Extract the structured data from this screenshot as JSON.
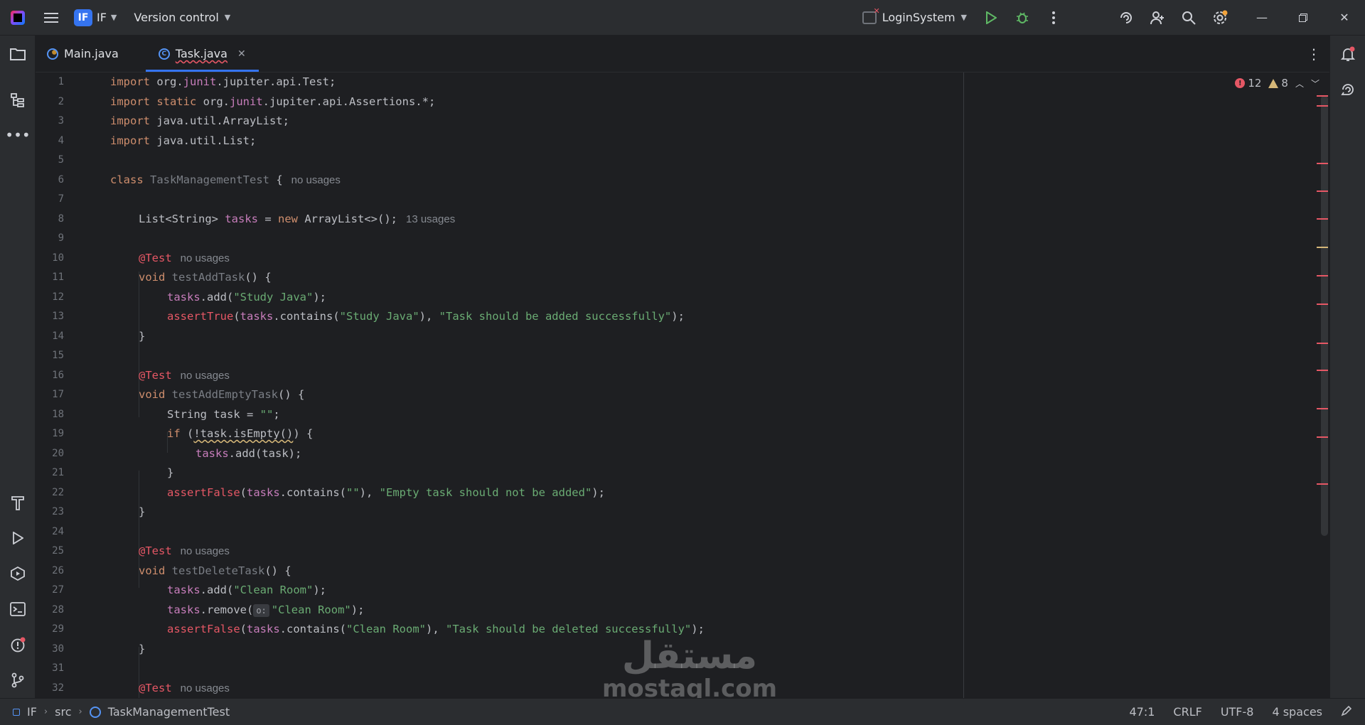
{
  "titlebar": {
    "project_badge": "IF",
    "project_name": "IF",
    "vcs_label": "Version control",
    "run_config": "LoginSystem"
  },
  "tabs": [
    {
      "label": "Main.java",
      "active": false
    },
    {
      "label": "Task.java",
      "active": true
    }
  ],
  "inspections": {
    "errors": "12",
    "warnings": "8"
  },
  "line_numbers": [
    "1",
    "2",
    "3",
    "4",
    "5",
    "6",
    "7",
    "8",
    "9",
    "10",
    "11",
    "12",
    "13",
    "14",
    "15",
    "16",
    "17",
    "18",
    "19",
    "20",
    "21",
    "22",
    "23",
    "24",
    "25",
    "26",
    "27",
    "28",
    "29",
    "30",
    "31",
    "32"
  ],
  "code": {
    "l1": {
      "kw": "import",
      "a": " org.",
      "pkg": "junit",
      "b": ".jupiter.api.Test;"
    },
    "l2": {
      "kw": "import static",
      "a": " org.",
      "pkg": "junit",
      "b": ".jupiter.api.Assertions.*;"
    },
    "l3": {
      "kw": "import",
      "a": " java.util.ArrayList;"
    },
    "l4": {
      "kw": "import",
      "a": " java.util.List;"
    },
    "l6": {
      "kw": "class",
      "name": "TaskManagementTest",
      "brace": " {",
      "hint": "no usages"
    },
    "l8": {
      "type": "List<String> ",
      "field": "tasks",
      "eq": " = ",
      "kw": "new",
      "rest": " ArrayList<>();",
      "hint": "13 usages"
    },
    "l10": {
      "ann": "@Test",
      "hint": "no usages"
    },
    "l11": {
      "kw": "void",
      "name": "testAddTask",
      "rest": "() {"
    },
    "l12": {
      "field": "tasks",
      "a": ".add(",
      "str": "\"Study Java\"",
      "b": ");"
    },
    "l13": {
      "fn": "assertTrue",
      "a": "(",
      "field": "tasks",
      "b": ".contains(",
      "str1": "\"Study Java\"",
      "c": "), ",
      "str2": "\"Task should be added successfully\"",
      "d": ");"
    },
    "l14": {
      "a": "}"
    },
    "l16": {
      "ann": "@Test",
      "hint": "no usages"
    },
    "l17": {
      "kw": "void",
      "name": "testAddEmptyTask",
      "rest": "() {"
    },
    "l18": {
      "a": "String task = ",
      "str": "\"\"",
      "b": ";"
    },
    "l19": {
      "kw": "if",
      "a": " (",
      "warn": "!task.isEmpty()",
      "b": ") {"
    },
    "l20": {
      "field": "tasks",
      "a": ".add(task);"
    },
    "l21": {
      "a": "}"
    },
    "l22": {
      "fn": "assertFalse",
      "a": "(",
      "field": "tasks",
      "b": ".contains(",
      "str1": "\"\"",
      "c": "), ",
      "str2": "\"Empty task should not be added\"",
      "d": ");"
    },
    "l23": {
      "a": "}"
    },
    "l25": {
      "ann": "@Test",
      "hint": "no usages"
    },
    "l26": {
      "kw": "void",
      "name": "testDeleteTask",
      "rest": "() {"
    },
    "l27": {
      "field": "tasks",
      "a": ".add(",
      "str": "\"Clean Room\"",
      "b": ");"
    },
    "l28": {
      "field": "tasks",
      "a": ".remove(",
      "inlay": "o:",
      "str": "\"Clean Room\"",
      "b": ");"
    },
    "l29": {
      "fn": "assertFalse",
      "a": "(",
      "field": "tasks",
      "b": ".contains(",
      "str1": "\"Clean Room\"",
      "c": "), ",
      "str2": "\"Task should be deleted successfully\"",
      "d": ");"
    },
    "l30": {
      "a": "}"
    },
    "l32": {
      "ann": "@Test",
      "hint": "no usages"
    }
  },
  "statusbar": {
    "project": "IF",
    "src": "src",
    "class_name": "TaskManagementTest",
    "position": "47:1",
    "line_sep": "CRLF",
    "encoding": "UTF-8",
    "indent": "4 spaces"
  },
  "watermark": {
    "arabic": "مستقل",
    "latin": "mostaql.com"
  },
  "colors": {
    "accent": "#3574f0",
    "error": "#e55765",
    "warning": "#d5b778",
    "string": "#6aab73",
    "keyword": "#cf8e6d"
  }
}
